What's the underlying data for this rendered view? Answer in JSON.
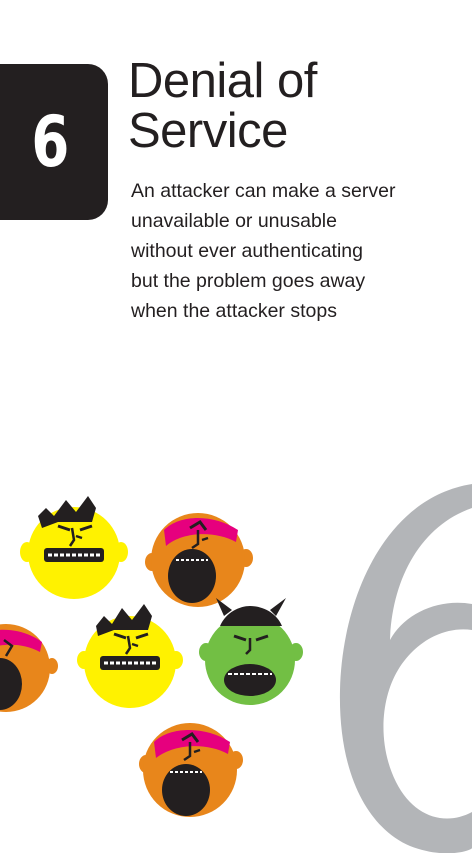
{
  "threat": {
    "number": "6",
    "title_lines": [
      "Denial of",
      "Service"
    ],
    "description_lines": [
      "An attacker can make a server",
      "unavailable or unusable",
      "without ever authenticating",
      "but the problem goes away",
      "when the attacker stops"
    ],
    "big_numeral": "6"
  },
  "colors": {
    "tab": "#231f20",
    "yellow": "#fff200",
    "orange": "#e8861b",
    "green": "#72bf44",
    "magenta": "#e6007e",
    "gray": "#b3b5b8"
  },
  "illustration": {
    "characters": [
      {
        "kind": "yellow-monster"
      },
      {
        "kind": "orange-pirate"
      },
      {
        "kind": "orange-pirate"
      },
      {
        "kind": "yellow-monster"
      },
      {
        "kind": "green-viking"
      },
      {
        "kind": "orange-pirate"
      }
    ]
  }
}
